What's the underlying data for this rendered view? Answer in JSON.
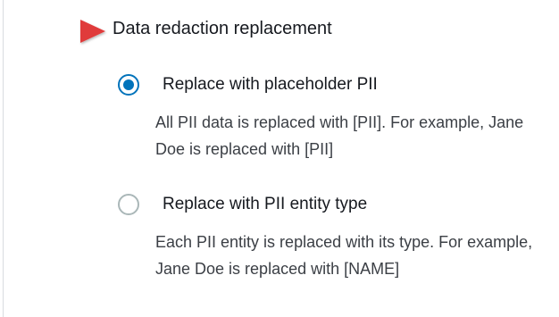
{
  "section": {
    "title": "Data redaction replacement"
  },
  "annotation": {
    "icon": "arrow-right-icon",
    "color": "#e03b3b"
  },
  "options": [
    {
      "label": "Replace with placeholder PII",
      "checked": true,
      "description": "All PII data is replaced with [PII]. For example, Jane Doe is replaced with [PII]"
    },
    {
      "label": "Replace with PII entity type",
      "checked": false,
      "description": "Each PII entity is replaced with its type. For example, Jane Doe is replaced with [NAME]"
    }
  ],
  "colors": {
    "accent": "#0073bb",
    "text": "#16191f",
    "muted_text": "#3b3f45",
    "radio_border": "#aab7b8"
  }
}
